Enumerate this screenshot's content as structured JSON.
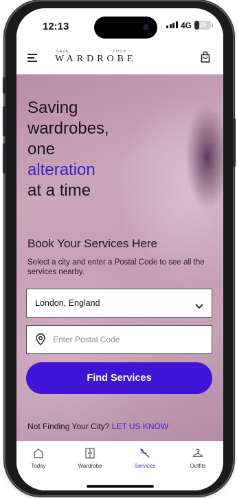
{
  "status_bar": {
    "time": "12:13",
    "network": "4G",
    "battery_level": "28",
    "battery_fraction": 0.28
  },
  "header": {
    "logo_small_left": "SAVE",
    "logo_small_right": "YOUR",
    "logo_main": "WARDROBE",
    "menu_icon": "hamburger-menu-icon",
    "bag_icon": "shopping-bag-icon"
  },
  "hero": {
    "headline_lines": [
      "Saving",
      "wardrobes,",
      "one"
    ],
    "headline_accent": "alteration",
    "headline_last": "at a time",
    "book_title": "Book Your Services Here",
    "description": "Select a city and enter a Postal Code to see all the services nearby."
  },
  "form": {
    "city_value": "London, England",
    "postal_placeholder": "Enter Postal Code",
    "postal_value": "",
    "find_button": "Find Services"
  },
  "footer_note": {
    "text": "Not Finding Your City?",
    "link": "LET US KNOW"
  },
  "tabs": [
    {
      "label": "Today",
      "icon": "today-icon",
      "active": false
    },
    {
      "label": "Wardrobe",
      "icon": "wardrobe-icon",
      "active": false
    },
    {
      "label": "Services",
      "icon": "needle-thread-icon",
      "active": true
    },
    {
      "label": "Outfits",
      "icon": "hanger-icon",
      "active": false
    }
  ],
  "colors": {
    "accent": "#3f14d6",
    "accent_text": "#3f1fc4"
  }
}
